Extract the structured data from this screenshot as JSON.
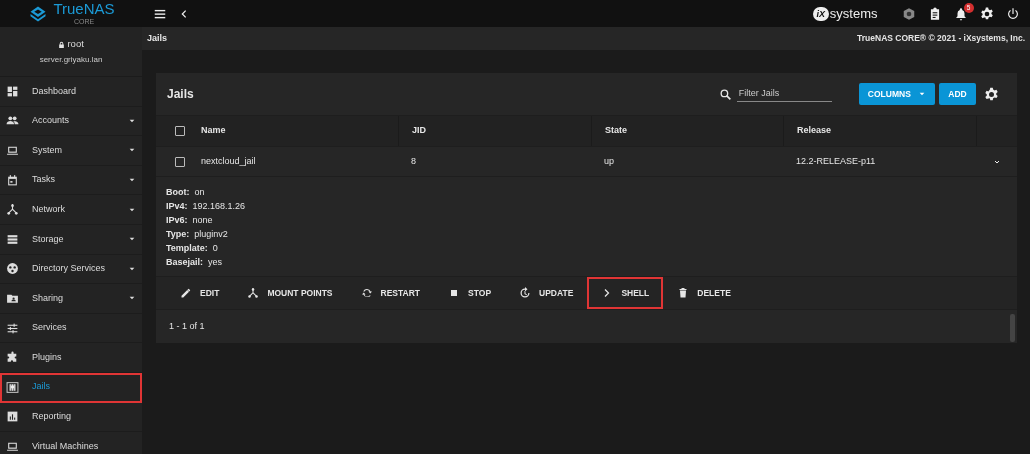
{
  "header": {
    "logo": "TrueNAS",
    "logo_sub": "CORE",
    "vendor_mark": "iX",
    "vendor_text": "systems",
    "notification_count": "5"
  },
  "user": {
    "name": "root",
    "host": "server.griyaku.lan"
  },
  "breadcrumb": {
    "title": "Jails",
    "copyright": "TrueNAS CORE® © 2021 - iXsystems, Inc."
  },
  "sidebar": {
    "items": [
      {
        "label": "Dashboard",
        "has_submenu": false,
        "selected": false,
        "highlighted": false
      },
      {
        "label": "Accounts",
        "has_submenu": true,
        "selected": false,
        "highlighted": false
      },
      {
        "label": "System",
        "has_submenu": true,
        "selected": false,
        "highlighted": false
      },
      {
        "label": "Tasks",
        "has_submenu": true,
        "selected": false,
        "highlighted": false
      },
      {
        "label": "Network",
        "has_submenu": true,
        "selected": false,
        "highlighted": false
      },
      {
        "label": "Storage",
        "has_submenu": true,
        "selected": false,
        "highlighted": false
      },
      {
        "label": "Directory Services",
        "has_submenu": true,
        "selected": false,
        "highlighted": false
      },
      {
        "label": "Sharing",
        "has_submenu": true,
        "selected": false,
        "highlighted": false
      },
      {
        "label": "Services",
        "has_submenu": false,
        "selected": false,
        "highlighted": false
      },
      {
        "label": "Plugins",
        "has_submenu": false,
        "selected": false,
        "highlighted": false
      },
      {
        "label": "Jails",
        "has_submenu": false,
        "selected": true,
        "highlighted": true
      },
      {
        "label": "Reporting",
        "has_submenu": false,
        "selected": false,
        "highlighted": false
      },
      {
        "label": "Virtual Machines",
        "has_submenu": false,
        "selected": false,
        "highlighted": false
      }
    ]
  },
  "card": {
    "title": "Jails",
    "filter": {
      "placeholder": "Filter Jails"
    },
    "buttons": [
      "COLUMNS",
      "ADD"
    ],
    "table": {
      "select_all": {
        "checked": false
      },
      "columns": [
        "Name",
        "JID",
        "State",
        "Release"
      ],
      "rows": [
        {
          "checked": false,
          "expanded": true,
          "cells": [
            "nextcloud_jail",
            "8",
            "up",
            "12.2-RELEASE-p11"
          ],
          "details": [
            {
              "label": "Boot:",
              "value": "on"
            },
            {
              "label": "IPv4:",
              "value": "192.168.1.26"
            },
            {
              "label": "IPv6:",
              "value": "none"
            },
            {
              "label": "Type:",
              "value": "pluginv2"
            },
            {
              "label": "Template:",
              "value": "0"
            },
            {
              "label": "Basejail:",
              "value": "yes"
            }
          ],
          "actions": [
            {
              "label": "EDIT",
              "highlighted": false
            },
            {
              "label": "MOUNT POINTS",
              "highlighted": false
            },
            {
              "label": "RESTART",
              "highlighted": false
            },
            {
              "label": "STOP",
              "highlighted": false
            },
            {
              "label": "UPDATE",
              "highlighted": false
            },
            {
              "label": "SHELL",
              "highlighted": true
            },
            {
              "label": "DELETE",
              "highlighted": false
            }
          ]
        }
      ]
    },
    "footer": "1 - 1 of 1"
  }
}
